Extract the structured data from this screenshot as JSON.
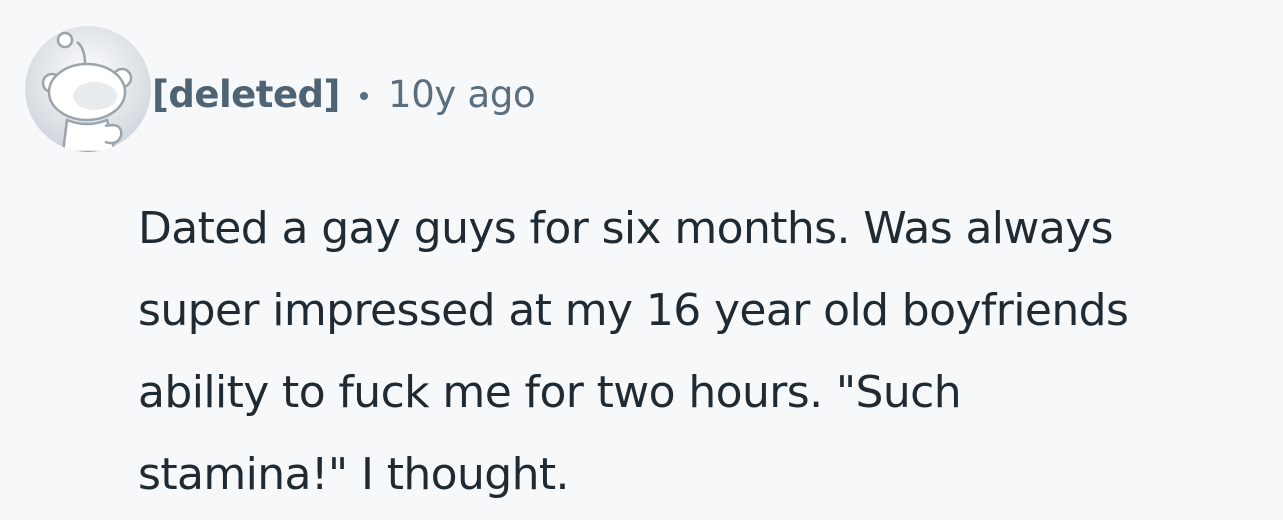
{
  "comment": {
    "author": "[deleted]",
    "separator_icon": "dot-separator",
    "timestamp": "10y ago",
    "avatar_icon": "snoo-avatar-icon",
    "body_lines": [
      "Dated a gay guys for six months. Was always",
      "super impressed at my 16 year old boyfriends",
      "ability to fuck me for two hours. \"Such",
      "stamina!\" I thought."
    ]
  },
  "colors": {
    "background": "#f6f8fa",
    "author": "#4e6374",
    "meta": "#5b6e7e",
    "body_text": "#1f2a33"
  }
}
